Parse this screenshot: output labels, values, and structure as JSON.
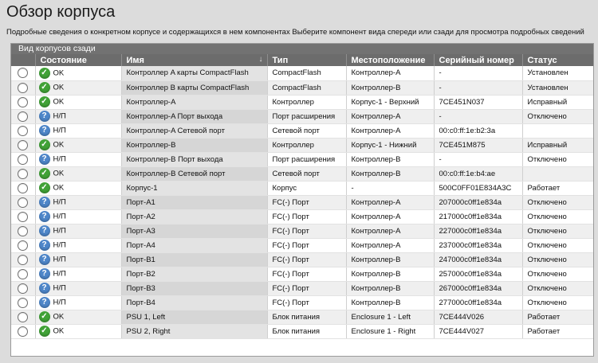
{
  "page": {
    "title": "Обзор корпуса",
    "description": "Подробные сведения о конкретном корпусе и содержащихся в нем компонентах Выберите компонент вида спереди или сзади для просмотра подробных сведений"
  },
  "panel": {
    "title": "Вид корпусов сзади"
  },
  "columns": {
    "state": "Состояние",
    "name": "Имя",
    "type": "Тип",
    "location": "Местоположение",
    "serial": "Серийный номер",
    "status": "Статус"
  },
  "colors": {
    "ok": "#41a237",
    "na": "#4e86c9",
    "header": "#6c6c6c"
  },
  "rows": [
    {
      "state": "OK",
      "icon": "ok",
      "name": "Контроллер A карты CompactFlash",
      "type": "CompactFlash",
      "location": "Контроллер-A",
      "serial": "-",
      "status": "Установлен"
    },
    {
      "state": "OK",
      "icon": "ok",
      "name": "Контроллер B карты CompactFlash",
      "type": "CompactFlash",
      "location": "Контроллер-B",
      "serial": "-",
      "status": "Установлен"
    },
    {
      "state": "OK",
      "icon": "ok",
      "name": "Контроллер-A",
      "type": "Контроллер",
      "location": "Корпус-1 - Верхний",
      "serial": "7CE451N037",
      "status": "Исправный"
    },
    {
      "state": "Н/П",
      "icon": "na",
      "name": "Контроллер-A Порт выхода",
      "type": "Порт расширения",
      "location": "Контроллер-A",
      "serial": "-",
      "status": "Отключено"
    },
    {
      "state": "Н/П",
      "icon": "na",
      "name": "Контроллер-A Сетевой порт",
      "type": "Сетевой порт",
      "location": "Контроллер-A",
      "serial": "00:c0:ff:1e:b2:3a",
      "status": ""
    },
    {
      "state": "OK",
      "icon": "ok",
      "name": "Контроллер-B",
      "type": "Контроллер",
      "location": "Корпус-1 - Нижний",
      "serial": "7CE451M875",
      "status": "Исправный"
    },
    {
      "state": "Н/П",
      "icon": "na",
      "name": "Контроллер-B Порт выхода",
      "type": "Порт расширения",
      "location": "Контроллер-B",
      "serial": "-",
      "status": "Отключено"
    },
    {
      "state": "OK",
      "icon": "ok",
      "name": "Контроллер-B Сетевой порт",
      "type": "Сетевой порт",
      "location": "Контроллер-B",
      "serial": "00:c0:ff:1e:b4:ae",
      "status": ""
    },
    {
      "state": "OK",
      "icon": "ok",
      "name": "Корпус-1",
      "type": "Корпус",
      "location": "-",
      "serial": "500C0FF01E834A3C",
      "status": "Работает"
    },
    {
      "state": "Н/П",
      "icon": "na",
      "name": "Порт-A1",
      "type": "FC(-) Порт",
      "location": "Контроллер-A",
      "serial": "207000c0ff1e834a",
      "status": "Отключено"
    },
    {
      "state": "Н/П",
      "icon": "na",
      "name": "Порт-A2",
      "type": "FC(-) Порт",
      "location": "Контроллер-A",
      "serial": "217000c0ff1e834a",
      "status": "Отключено"
    },
    {
      "state": "Н/П",
      "icon": "na",
      "name": "Порт-A3",
      "type": "FC(-) Порт",
      "location": "Контроллер-A",
      "serial": "227000c0ff1e834a",
      "status": "Отключено"
    },
    {
      "state": "Н/П",
      "icon": "na",
      "name": "Порт-A4",
      "type": "FC(-) Порт",
      "location": "Контроллер-A",
      "serial": "237000c0ff1e834a",
      "status": "Отключено"
    },
    {
      "state": "Н/П",
      "icon": "na",
      "name": "Порт-B1",
      "type": "FC(-) Порт",
      "location": "Контроллер-B",
      "serial": "247000c0ff1e834a",
      "status": "Отключено"
    },
    {
      "state": "Н/П",
      "icon": "na",
      "name": "Порт-B2",
      "type": "FC(-) Порт",
      "location": "Контроллер-B",
      "serial": "257000c0ff1e834a",
      "status": "Отключено"
    },
    {
      "state": "Н/П",
      "icon": "na",
      "name": "Порт-B3",
      "type": "FC(-) Порт",
      "location": "Контроллер-B",
      "serial": "267000c0ff1e834a",
      "status": "Отключено"
    },
    {
      "state": "Н/П",
      "icon": "na",
      "name": "Порт-B4",
      "type": "FC(-) Порт",
      "location": "Контроллер-B",
      "serial": "277000c0ff1e834a",
      "status": "Отключено"
    },
    {
      "state": "OK",
      "icon": "ok",
      "name": "PSU 1, Left",
      "type": "Блок питания",
      "location": "Enclosure 1 - Left",
      "serial": "7CE444V026",
      "status": "Работает"
    },
    {
      "state": "OK",
      "icon": "ok",
      "name": "PSU 2, Right",
      "type": "Блок питания",
      "location": "Enclosure 1 - Right",
      "serial": "7CE444V027",
      "status": "Работает"
    }
  ]
}
